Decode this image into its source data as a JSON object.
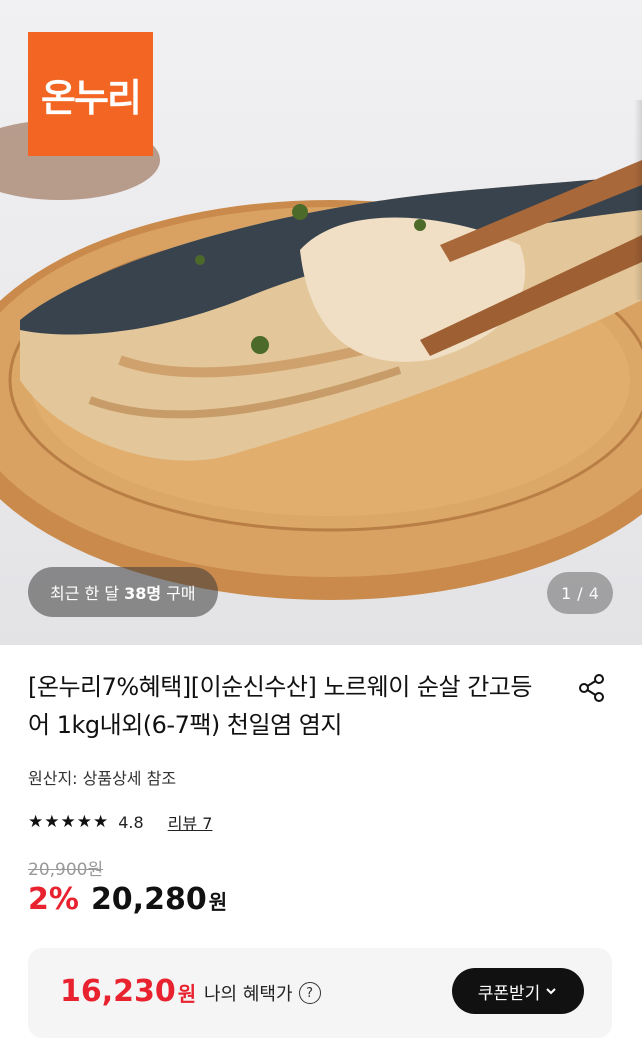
{
  "hero": {
    "logo_text": "온누리",
    "logo_color": "#f26522",
    "recent_buyers": {
      "prefix": "최근 한 달",
      "count": "38명",
      "suffix": "구매"
    },
    "image_counter": {
      "current": "1",
      "separator": "/",
      "total": "4"
    }
  },
  "product": {
    "title": "[온누리7%혜택][이순신수산] 노르웨이 순살 간고등어 1kg내외(6-7팩) 천일염 염지",
    "origin": "원산지: 상품상세 참조",
    "rating": {
      "stars": 5,
      "score": "4.8",
      "review_label": "리뷰 7"
    },
    "original_price": "20,900원",
    "discount_rate": "2%",
    "sale_price": "20,280",
    "currency": "원"
  },
  "benefit": {
    "price": "16,230",
    "currency": "원",
    "label": "나의 혜택가",
    "help_icon": "?",
    "coupon_button": "쿠폰받기",
    "accent_color": "#e8232f"
  },
  "icons": {
    "share": "share-icon",
    "chevron": "chevron-down-icon",
    "star": "star-icon"
  }
}
